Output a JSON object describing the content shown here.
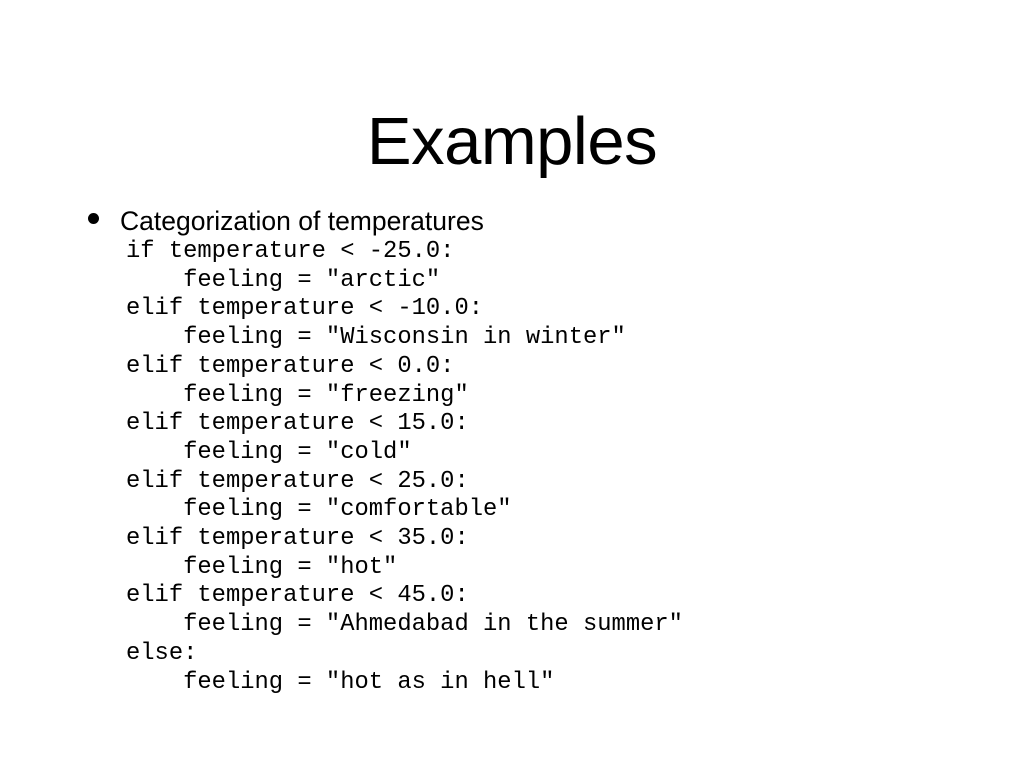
{
  "slide": {
    "title": "Examples",
    "background_color": "#ffffff",
    "text_color": "#000000"
  },
  "bullets": [
    {
      "marker": "bullet-dot",
      "text": "Categorization of temperatures"
    }
  ],
  "code": {
    "language": "python",
    "lines": [
      "if temperature < -25.0:",
      "    feeling = \"arctic\"",
      "elif temperature < -10.0:",
      "    feeling = \"Wisconsin in winter\"",
      "elif temperature < 0.0:",
      "    feeling = \"freezing\"",
      "elif temperature < 15.0:",
      "    feeling = \"cold\"",
      "elif temperature < 25.0:",
      "    feeling = \"comfortable\"",
      "elif temperature < 35.0:",
      "    feeling = \"hot\"",
      "elif temperature < 45.0:",
      "    feeling = \"Ahmedabad in the summer\"",
      "else:",
      "    feeling = \"hot as in hell\""
    ]
  }
}
